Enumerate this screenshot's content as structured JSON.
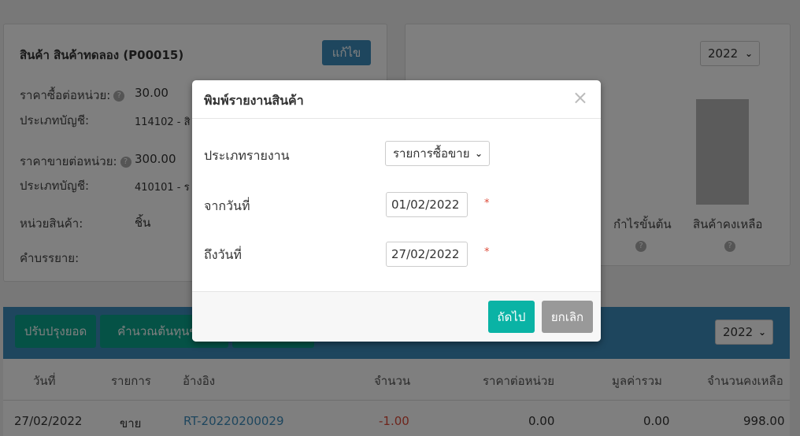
{
  "product": {
    "title": "สินค้า สินค้าทดลอง (P00015)",
    "edit_label": "แก้ไข",
    "buy_price_label": "ราคาซื้อต่อหน่วย:",
    "buy_price": "30.00",
    "buy_account_label": "ประเภทบัญชี:",
    "buy_account": "114102 - สิ",
    "sell_price_label": "ราคาขายต่อหน่วย:",
    "sell_price": "300.00",
    "sell_account_label": "ประเภทบัญชี:",
    "sell_account": "410101 - ร",
    "unit_label": "หน่วยสินค้า:",
    "unit": "ชิ้น",
    "description_label": "คำบรรยาย:",
    "help_glyph": "?"
  },
  "chart": {
    "year": "2022",
    "labels": [
      "กำไรขั้นต้น",
      "สินค้าคงเหลือ"
    ],
    "help_glyph": "?"
  },
  "chart_data": {
    "type": "bar",
    "categories": [
      "กำไรขั้นต้น",
      "สินค้าคงเหลือ"
    ],
    "values": [
      0,
      998
    ],
    "title": "",
    "xlabel": "",
    "ylabel": ""
  },
  "toolbar": {
    "adjust_label": "ปรับปรุงยอด",
    "calc_cost_label": "คำนวณต้นทุนขาย",
    "year": "2022"
  },
  "table": {
    "headers": [
      "วันที่",
      "รายการ",
      "อ้างอิง",
      "จำนวน",
      "ราคาต่อหน่วย",
      "มูลค่ารวม",
      "จำนวนคงเหลือ"
    ],
    "rows": [
      [
        "27/02/2022",
        "ขาย",
        "RT-20220200029",
        "-1.00",
        "0.00",
        "0.00",
        "998.00"
      ]
    ]
  },
  "modal": {
    "title": "พิมพ์รายงานสินค้า",
    "close_glyph": "×",
    "report_type_label": "ประเภทรายงาน",
    "report_type_value": "รายการซื้อขาย",
    "from_label": "จากวันที่",
    "from_value": "01/02/2022",
    "to_label": "ถึงวันที่",
    "to_value": "27/02/2022",
    "required_mark": "*",
    "next_label": "ถัดไป",
    "cancel_label": "ยกเลิก"
  },
  "colors": {
    "primary": "#3c8dbc",
    "teal": "#0aa58d",
    "danger": "#dd4b39",
    "link": "#3c8dbc",
    "cancel": "#999999"
  }
}
